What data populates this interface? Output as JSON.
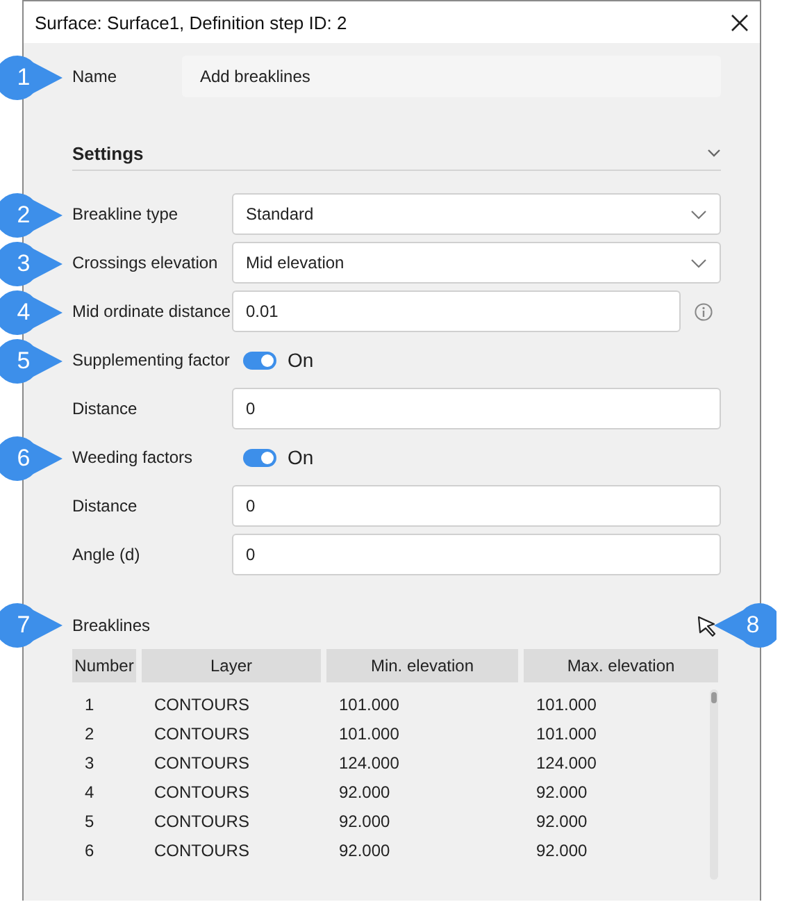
{
  "window": {
    "title": "Surface: Surface1, Definition step ID: 2"
  },
  "name_field": {
    "label": "Name",
    "value": "Add breaklines",
    "callout": "1"
  },
  "settings": {
    "title": "Settings",
    "expanded": true,
    "fields": [
      {
        "kind": "dropdown",
        "label": "Breakline type",
        "value": "Standard",
        "callout": "2"
      },
      {
        "kind": "dropdown",
        "label": "Crossings elevation",
        "value": "Mid elevation",
        "callout": "3"
      },
      {
        "kind": "text",
        "label": "Mid ordinate distance",
        "value": "0.01",
        "info": true,
        "callout": "4"
      },
      {
        "kind": "toggle",
        "label": "Supplementing factor",
        "on": true,
        "state_label": "On",
        "callout": "5"
      },
      {
        "kind": "text",
        "label": "Distance",
        "value": "0"
      },
      {
        "kind": "toggle",
        "label": "Weeding factors",
        "on": true,
        "state_label": "On",
        "callout": "6"
      },
      {
        "kind": "text",
        "label": "Distance",
        "value": "0"
      },
      {
        "kind": "text",
        "label": "Angle (d)",
        "value": "0"
      }
    ]
  },
  "breaklines": {
    "title": "Breaklines",
    "callout": "7",
    "pick_callout": "8",
    "columns": [
      "Number",
      "Layer",
      "Min. elevation",
      "Max. elevation"
    ],
    "rows": [
      [
        "1",
        "CONTOURS",
        "101.000",
        "101.000"
      ],
      [
        "2",
        "CONTOURS",
        "101.000",
        "101.000"
      ],
      [
        "3",
        "CONTOURS",
        "124.000",
        "124.000"
      ],
      [
        "4",
        "CONTOURS",
        "92.000",
        "92.000"
      ],
      [
        "5",
        "CONTOURS",
        "92.000",
        "92.000"
      ],
      [
        "6",
        "CONTOURS",
        "92.000",
        "92.000"
      ]
    ]
  }
}
